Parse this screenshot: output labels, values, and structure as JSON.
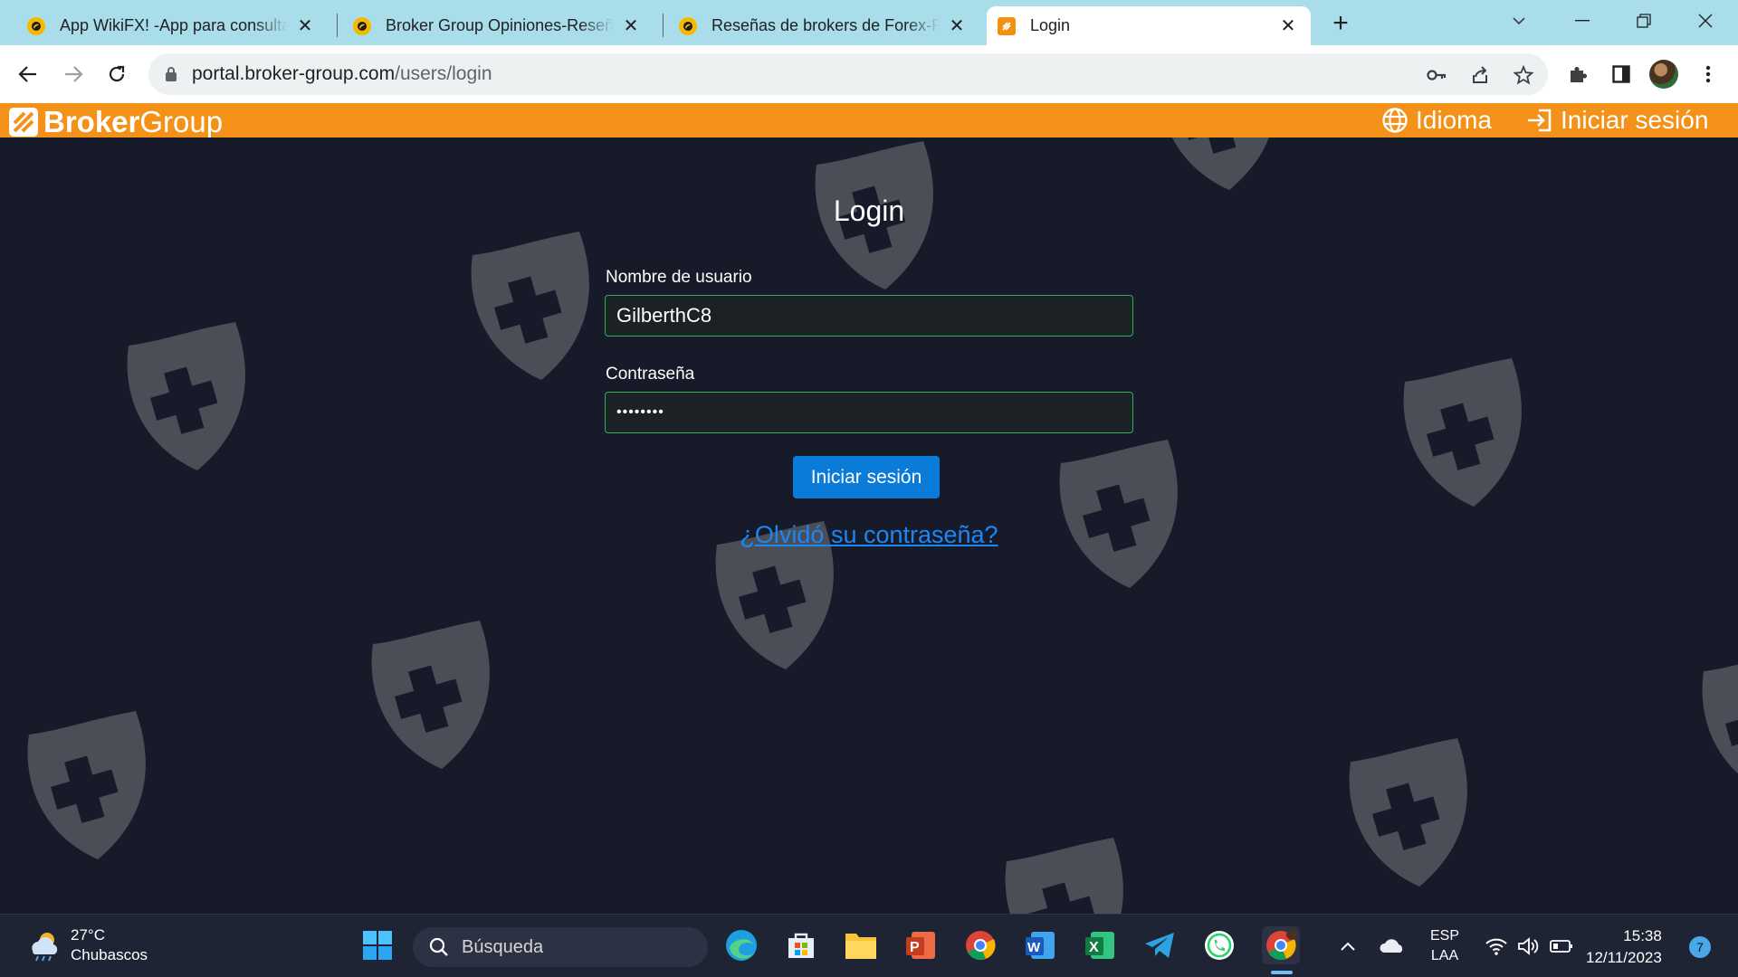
{
  "browser": {
    "tabs": [
      {
        "title": "App WikiFX! -App para consultar"
      },
      {
        "title": "Broker Group Opiniones-Reseñas"
      },
      {
        "title": "Reseñas de brokers de Forex-Pla"
      },
      {
        "title": "Login"
      }
    ],
    "url_domain": "portal.broker-group.com",
    "url_path": "/users/login"
  },
  "site": {
    "logo_bold": "Broker",
    "logo_light": "Group",
    "nav_language": "Idioma",
    "nav_login": "Iniciar sesión"
  },
  "login": {
    "title": "Login",
    "username_label": "Nombre de usuario",
    "username_value": "GilberthC8",
    "password_label": "Contraseña",
    "password_value": "••••••••",
    "submit_label": "Iniciar sesión",
    "forgot_label": "¿Olvidó su contraseña?"
  },
  "taskbar": {
    "weather_temp": "27°C",
    "weather_desc": "Chubascos",
    "search_placeholder": "Búsqueda",
    "lang_top": "ESP",
    "lang_bottom": "LAA",
    "time": "15:38",
    "date": "12/11/2023",
    "notifications": "7"
  },
  "colors": {
    "brand_orange": "#f39118",
    "page_bg": "#171b29",
    "primary_button": "#0a7bd8",
    "link": "#1b87f4",
    "input_border": "#2fae5a"
  }
}
